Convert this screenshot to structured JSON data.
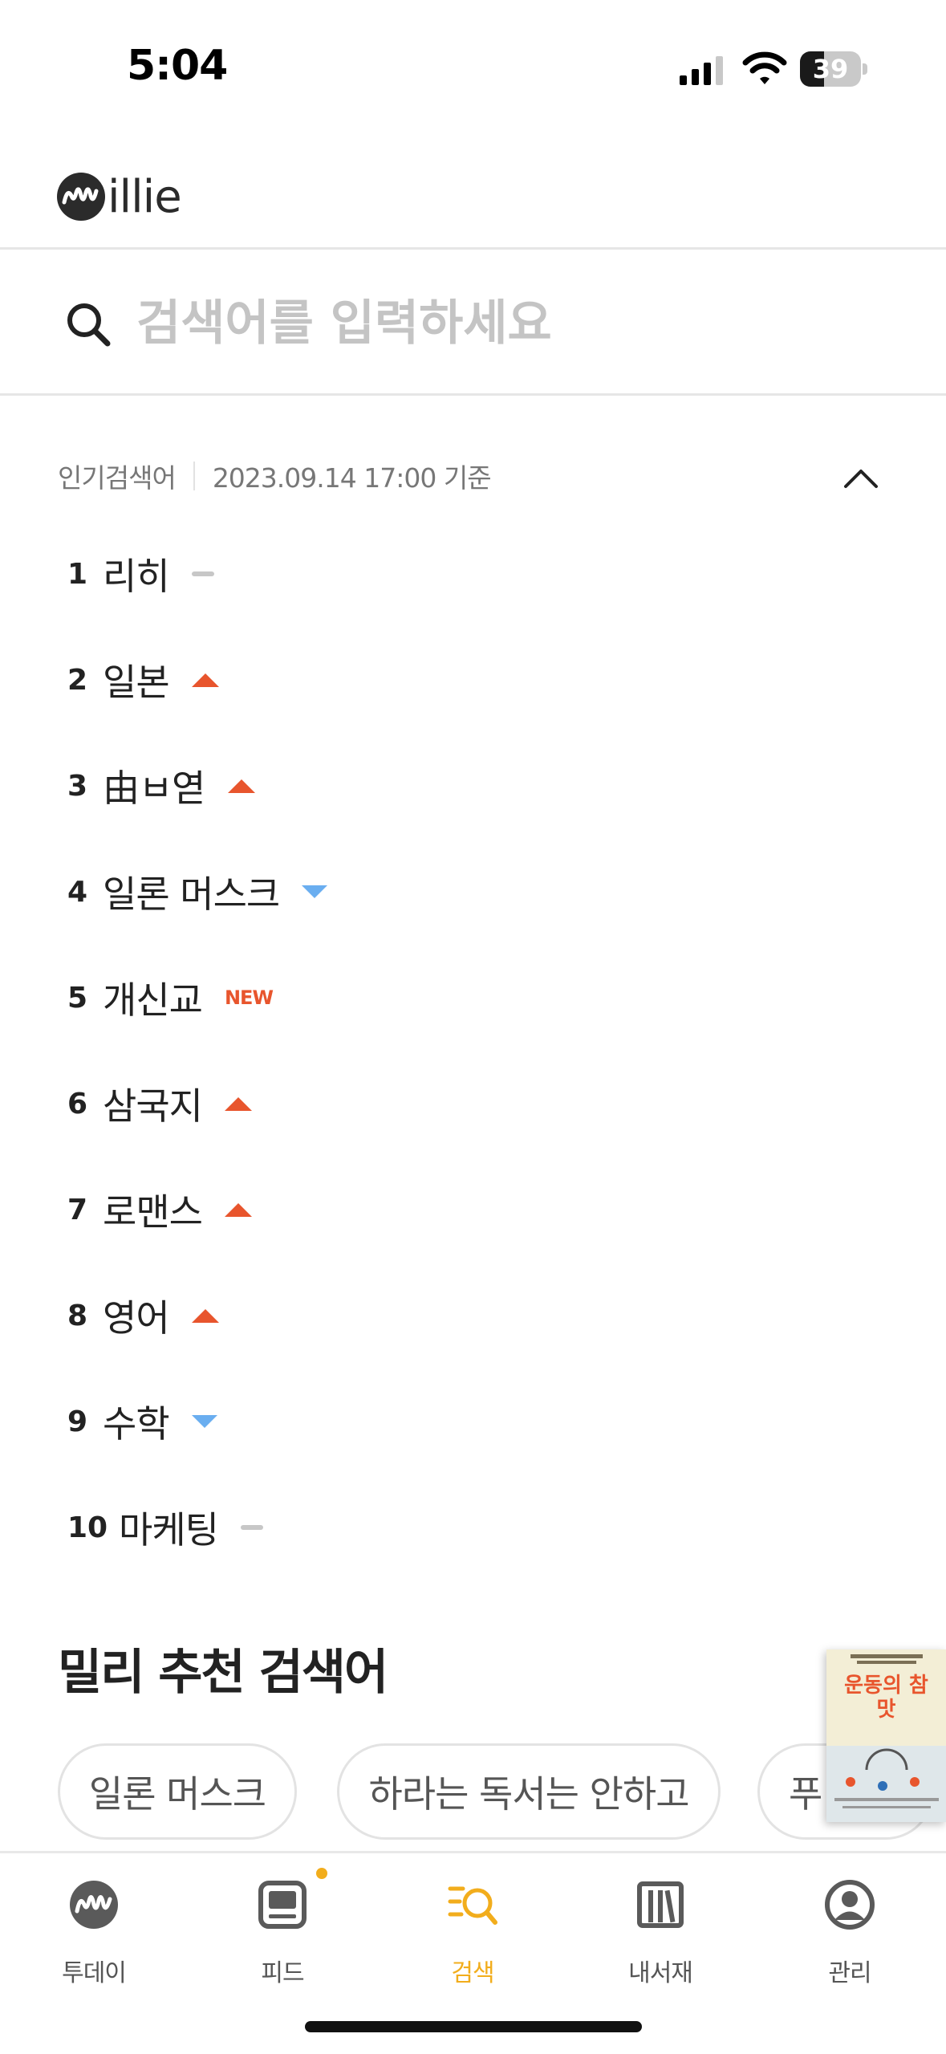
{
  "status_bar": {
    "time": "5:04",
    "battery_level": "39"
  },
  "header": {
    "logo_text": "illie"
  },
  "search": {
    "placeholder": "검색어를 입력하세요"
  },
  "popular": {
    "label": "인기검색어",
    "timestamp": "2023.09.14 17:00 기준",
    "items": [
      {
        "rank": "1",
        "term": "리히",
        "trend": "same"
      },
      {
        "rank": "2",
        "term": "일본",
        "trend": "up"
      },
      {
        "rank": "3",
        "term": "由ㅂ엳",
        "trend": "up"
      },
      {
        "rank": "4",
        "term": "일론 머스크",
        "trend": "down"
      },
      {
        "rank": "5",
        "term": "개신교",
        "trend": "new",
        "badge": "NEW"
      },
      {
        "rank": "6",
        "term": "삼국지",
        "trend": "up"
      },
      {
        "rank": "7",
        "term": "로맨스",
        "trend": "up"
      },
      {
        "rank": "8",
        "term": "영어",
        "trend": "up"
      },
      {
        "rank": "9",
        "term": "수학",
        "trend": "down"
      },
      {
        "rank": "10",
        "term": "마케팅",
        "trend": "same"
      }
    ]
  },
  "recommended": {
    "title": "밀리 추천 검색어",
    "chips": [
      "일론 머스크",
      "하라는 독서는 안하고",
      "푸"
    ]
  },
  "floating_book": {
    "title": "운동의 참맛"
  },
  "tabs": [
    {
      "label": "투데이",
      "icon": "millie-logo-icon"
    },
    {
      "label": "피드",
      "icon": "feed-icon"
    },
    {
      "label": "검색",
      "icon": "search-tab-icon",
      "active": true
    },
    {
      "label": "내서재",
      "icon": "bookshelf-icon"
    },
    {
      "label": "관리",
      "icon": "profile-icon"
    }
  ],
  "colors": {
    "accent": "#f2ad1c",
    "trend_up": "#e8552d",
    "trend_down": "#6aaef0",
    "trend_same": "#c7c7c7"
  }
}
